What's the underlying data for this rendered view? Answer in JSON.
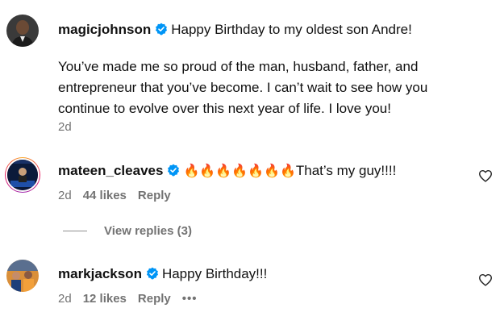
{
  "comments": [
    {
      "username": "magicjohnson",
      "text_first": "Happy Birthday to my oldest son Andre!",
      "text_lines": [
        "You’ve made me so proud of the man, husband, father, and",
        "entrepreneur that you’ve become. I can’t wait to see how you",
        "continue to evolve over this next year of life. I love you!"
      ],
      "time": "2d"
    },
    {
      "username": "mateen_cleaves",
      "emojis": "🔥🔥🔥🔥🔥🔥🔥",
      "text": "That’s my guy!!!!",
      "time": "2d",
      "likes": "44 likes",
      "reply": "Reply",
      "view_replies": "View replies (3)"
    },
    {
      "username": "markjackson",
      "text": "Happy Birthday!!!",
      "time": "2d",
      "likes": "12 likes",
      "reply": "Reply",
      "more": "•••"
    }
  ],
  "colors": {
    "verified": "#0095f6",
    "meta": "#737373"
  },
  "icons": {
    "verified": "verified-badge-icon",
    "like": "heart-outline-icon",
    "more": "more-options-icon"
  }
}
